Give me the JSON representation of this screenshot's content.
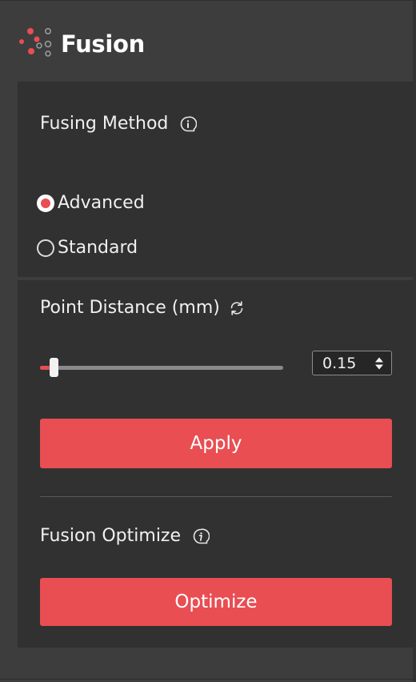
{
  "app": {
    "title": "Fusion"
  },
  "fusing_method": {
    "title": "Fusing Method",
    "options": [
      {
        "label": "Advanced",
        "selected": true
      },
      {
        "label": "Standard",
        "selected": false
      }
    ]
  },
  "point_distance": {
    "title": "Point Distance (mm)",
    "value": "0.15",
    "slider_fraction": 0.04
  },
  "actions": {
    "apply_label": "Apply"
  },
  "fusion_optimize": {
    "title": "Fusion Optimize",
    "button_label": "Optimize"
  },
  "icons": {
    "logo": "fusion-logo",
    "method_info": "info-icon",
    "refresh": "refresh-icon",
    "optimize_info": "info-icon",
    "spinner": "spinner-arrows-icon"
  },
  "colors": {
    "accent": "#e84e52",
    "background": "#3d3d3d",
    "panel": "#313131"
  }
}
